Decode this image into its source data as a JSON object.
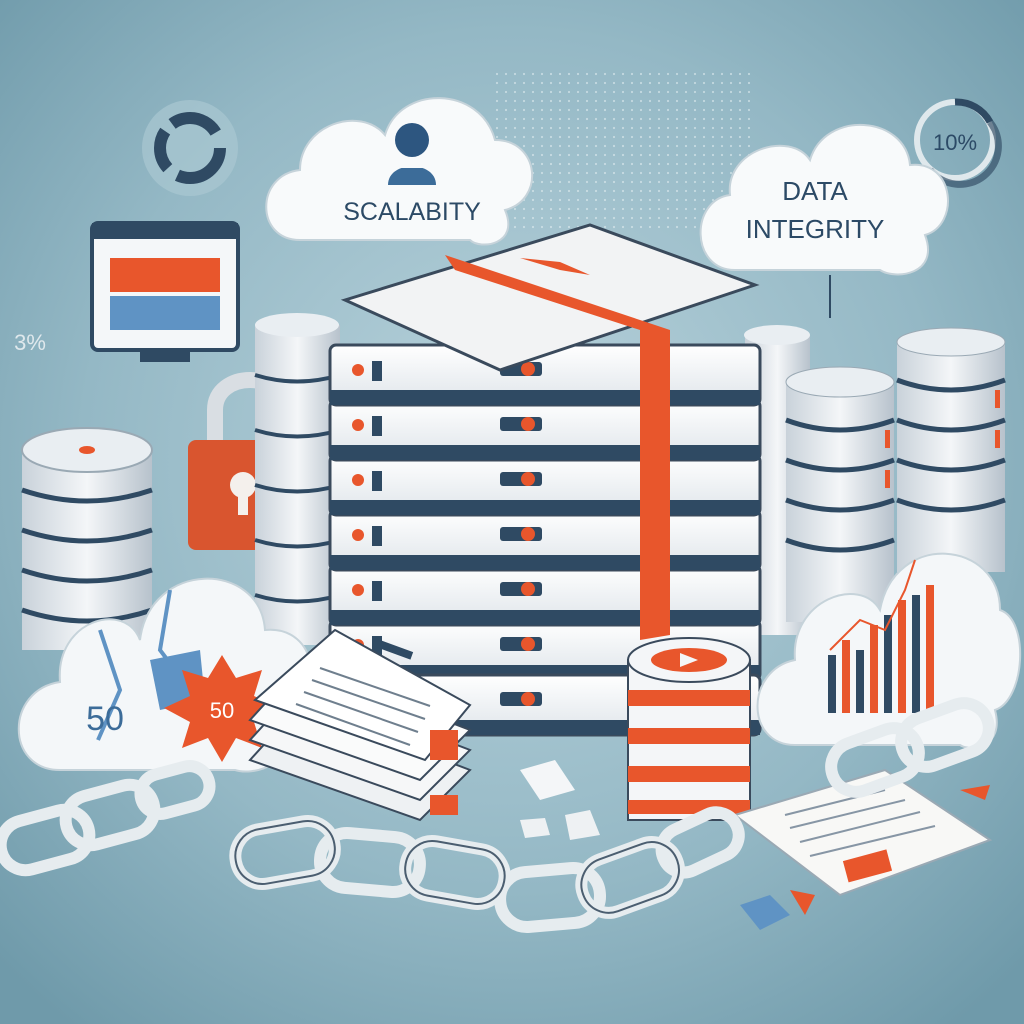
{
  "scene": {
    "cloud_left_label": "SCALABITY",
    "cloud_right_label_line1": "DATA",
    "cloud_right_label_line2": "INTEGRITY",
    "percent_badge": "10%",
    "broken_cloud_number": "50",
    "burst_badge_number": "50",
    "side_mark_left": "3%",
    "colors": {
      "background": "#8fb3c0",
      "accent": "#e8562c",
      "server_body": "#f2f3f4",
      "server_edge": "#3a4a5c",
      "chain": "#e6ecef",
      "cloud": "#f7f9fa",
      "text_dark": "#2c4a66"
    },
    "icons": [
      "donut-chart-icon",
      "cloud-user-icon",
      "monitor-icon",
      "padlock-icon",
      "server-stack-icon",
      "database-cylinder-icon",
      "broken-chain-icon",
      "document-stack-icon",
      "cloud-bar-chart-icon"
    ]
  }
}
